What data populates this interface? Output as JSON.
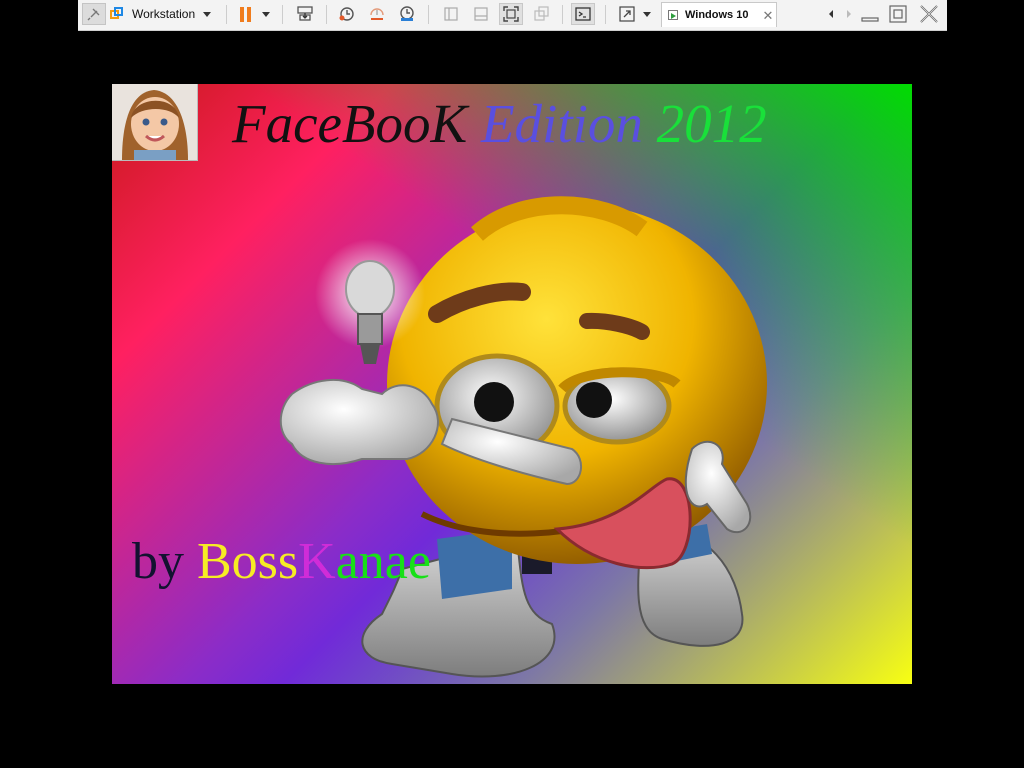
{
  "toolbar": {
    "workstation_label": "Workstation",
    "tab_label": "Windows 10",
    "tab_close": "✕"
  },
  "screen": {
    "title_part1": "FaceBooK",
    "title_part2": "Edition",
    "title_part3": "2012",
    "byline_by": "by",
    "byline_boss": "Boss",
    "byline_k": "K",
    "byline_anae": "anae"
  },
  "colors": {
    "toolbar_bg": "#f3f3f3",
    "pause_orange": "#f07c1d",
    "title_edition": "#5a4fe0",
    "title_year": "#19e03a",
    "byline_boss": "#f6ec24",
    "byline_k": "#d02cd8",
    "byline_anae": "#18e018"
  },
  "icons": [
    "pin-icon",
    "workstation-logo-icon",
    "pause-icon",
    "send-ctrl-alt-del-icon",
    "snapshot-icon",
    "revert-snapshot-icon",
    "snapshot-manager-icon",
    "console-view-icon",
    "full-screen-icon",
    "unity-icon",
    "no-border-icon",
    "console-icon",
    "stretch-icon",
    "vm-tab-icon",
    "scroll-left-icon",
    "scroll-right-icon",
    "minimize-icon",
    "restore-icon",
    "close-icon"
  ]
}
